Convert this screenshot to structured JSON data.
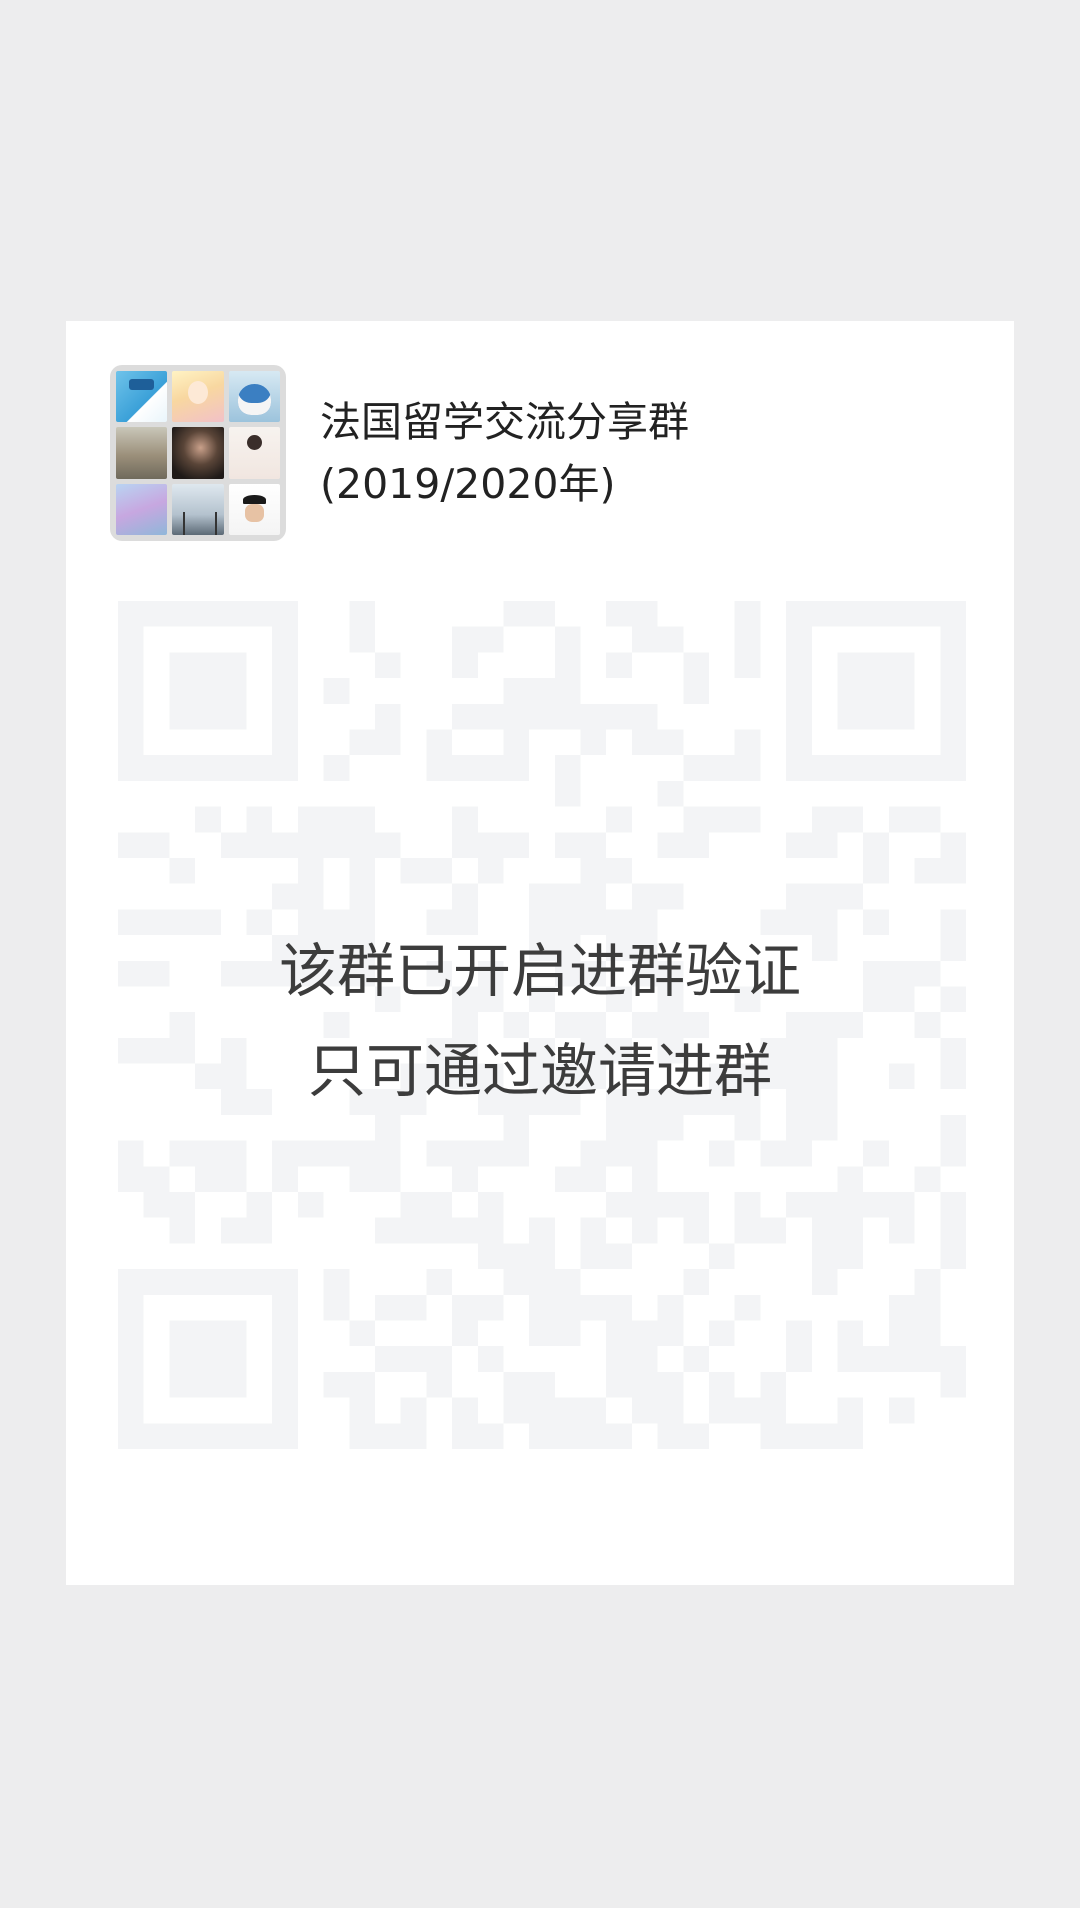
{
  "group": {
    "name_line1": "法国留学交流分享群",
    "name_line2": "(2019/2020年)"
  },
  "notice": {
    "line1": "该群已开启进群验证",
    "line2": "只可通过邀请进群"
  },
  "avatar": {
    "icon": "group-avatar-icon",
    "tile_count": 9
  },
  "qr": {
    "icon": "qr-code-icon",
    "state": "disabled"
  },
  "colors": {
    "background": "#ededee",
    "card": "#ffffff",
    "title_text": "#222222",
    "notice_text": "#3c3c3c",
    "qr_faded": "#f3f4f6"
  }
}
